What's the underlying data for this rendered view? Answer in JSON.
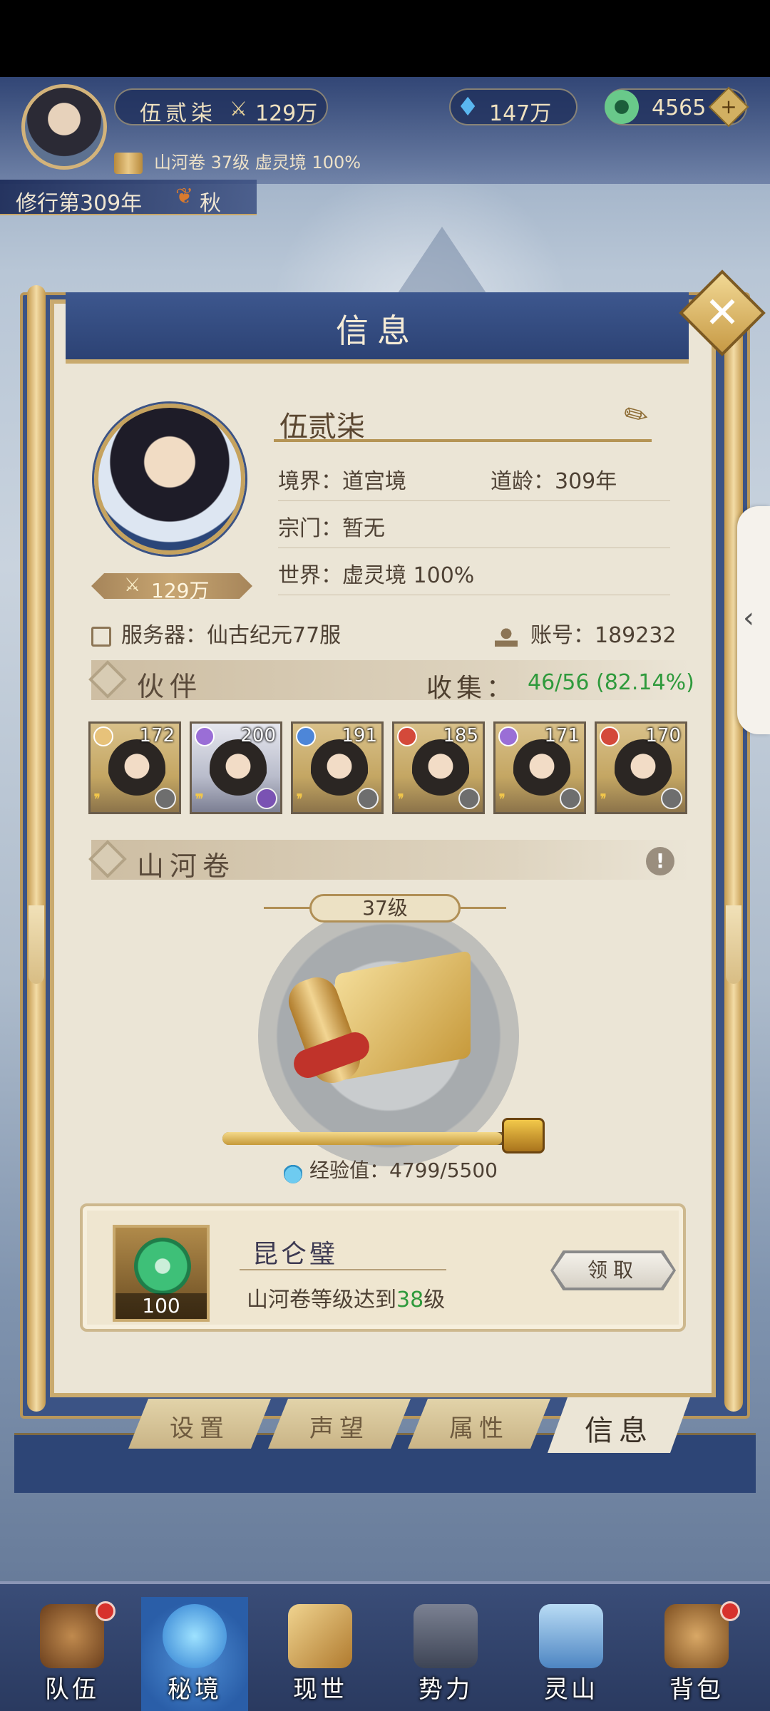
{
  "top": {
    "player_name": "伍贰柒",
    "power": "129万",
    "spirit_stone": "147万",
    "jade": "4565",
    "plus_symbol": "+",
    "scroll_info": "山河卷 37级 虚灵境 100%",
    "year": "修行第309年",
    "season": "秋",
    "leaf_icon": "❦"
  },
  "panel": {
    "title": "信息",
    "close_symbol": "✕",
    "brush_icon": "✎"
  },
  "profile": {
    "name": "伍贰柒",
    "power_icon": "⚔",
    "power": "129万",
    "realm": "境界：道宫境",
    "age": "道龄：309年",
    "sect": "宗门：暂无",
    "world": "世界：虚灵境  100%",
    "server": "服务器：仙古纪元77服",
    "account": "账号：189232"
  },
  "partners": {
    "title": "伙伴",
    "collect_label": "收集：",
    "collect_value": "46/56 (82.14%)",
    "cards": [
      {
        "level": "172",
        "element_color": "#e7c27a",
        "stars": "❜❜",
        "rare": false
      },
      {
        "level": "200",
        "element_color": "#9a6ed6",
        "stars": "❜❜❜",
        "rare": true
      },
      {
        "level": "191",
        "element_color": "#4d86d8",
        "stars": "❜❜",
        "rare": false
      },
      {
        "level": "185",
        "element_color": "#d4493a",
        "stars": "❜❜",
        "rare": false
      },
      {
        "level": "171",
        "element_color": "#9a6ed6",
        "stars": "❜❜",
        "rare": false
      },
      {
        "level": "170",
        "element_color": "#d4493a",
        "stars": "❜❜",
        "rare": false
      }
    ]
  },
  "scroll": {
    "title": "山河卷",
    "warn_symbol": "!",
    "level": "37级",
    "exp_label": "经验值：4799/5500",
    "exp_progress": 0.8725
  },
  "reward": {
    "count": "100",
    "name": "昆仑璧",
    "desc_prefix": "山河卷等级达到",
    "desc_level": "38",
    "desc_suffix": "级",
    "claim_label": "领取"
  },
  "tabs": [
    {
      "label": "设置",
      "active": false
    },
    {
      "label": "声望",
      "active": false
    },
    {
      "label": "属性",
      "active": false
    },
    {
      "label": "信息",
      "active": true
    }
  ],
  "nav": [
    {
      "label": "队伍",
      "badge": true,
      "active": false,
      "color": "#8b5a2b"
    },
    {
      "label": "秘境",
      "badge": false,
      "active": true,
      "color": "#3c9be0"
    },
    {
      "label": "现世",
      "badge": false,
      "active": false,
      "color": "#d2a24e"
    },
    {
      "label": "势力",
      "badge": false,
      "active": false,
      "color": "#5a6274"
    },
    {
      "label": "灵山",
      "badge": false,
      "active": false,
      "color": "#6fa7d8"
    },
    {
      "label": "背包",
      "badge": true,
      "active": false,
      "color": "#b07a3a"
    }
  ],
  "side_handle_symbol": "‹"
}
